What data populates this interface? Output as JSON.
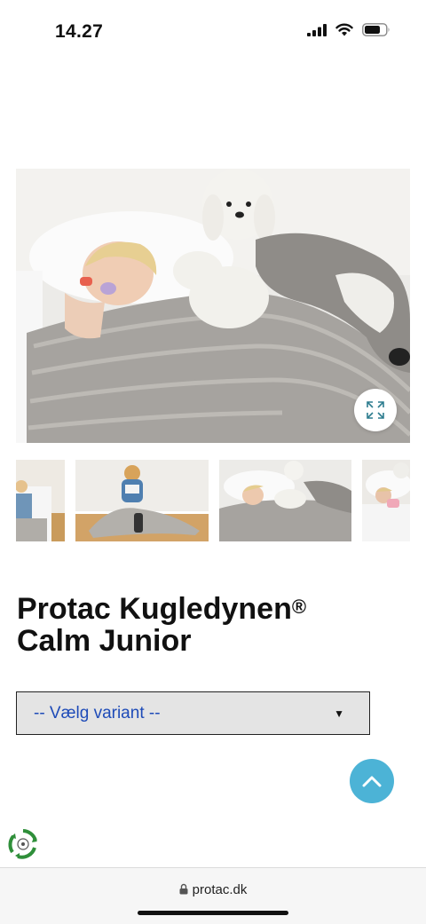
{
  "status_bar": {
    "time": "14.27",
    "icons": [
      "signal-icon",
      "wifi-icon",
      "battery-icon"
    ]
  },
  "gallery": {
    "main_image": "child-sleeping-under-gray-blanket-with-plush-toys",
    "zoom_icon": "expand-icon",
    "thumbnails": [
      "child-in-bed-thumbnail",
      "child-reading-with-blanket-thumbnail",
      "child-sleeping-with-plush-toys-thumbnail",
      "child-in-bed-partial-thumbnail"
    ]
  },
  "product": {
    "title_line1": "Protac Kugledynen",
    "title_mark": "®",
    "title_line2": "Calm Junior"
  },
  "variant_select": {
    "placeholder": "-- Vælg variant --",
    "caret": "▼"
  },
  "back_to_top_icon": "chevron-up-icon",
  "recycle_icon": "recycle-logo-icon",
  "browser": {
    "url": "protac.dk",
    "lock_icon": "lock-icon"
  },
  "colors": {
    "accent_blue": "#4cb3d6",
    "select_text": "#1e4bb8",
    "select_bg": "#e4e4e4"
  }
}
